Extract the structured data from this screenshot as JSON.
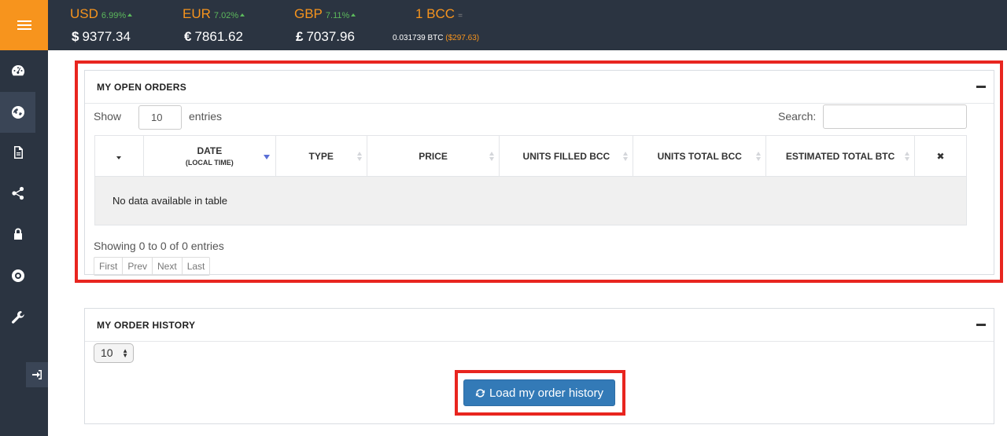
{
  "ticker": [
    {
      "code": "USD",
      "pct": "6.99%",
      "symbol": "$",
      "value": "9377.34"
    },
    {
      "code": "EUR",
      "pct": "7.02%",
      "symbol": "€",
      "value": "7861.62"
    },
    {
      "code": "GBP",
      "pct": "7.11%",
      "symbol": "£",
      "value": "7037.96"
    }
  ],
  "bcc": {
    "label": "1 BCC",
    "eq": "=",
    "btc": "0.031739 BTC",
    "usd": "($297.63)"
  },
  "open_orders": {
    "title": "MY OPEN ORDERS",
    "show_label": "Show",
    "entries_value": "10",
    "entries_label": "entries",
    "search_label": "Search:",
    "columns": [
      {
        "label": "",
        "sub": ""
      },
      {
        "label": "DATE",
        "sub": "(LOCAL TIME)"
      },
      {
        "label": "TYPE",
        "sub": ""
      },
      {
        "label": "PRICE",
        "sub": ""
      },
      {
        "label": "UNITS FILLED BCC",
        "sub": ""
      },
      {
        "label": "UNITS TOTAL BCC",
        "sub": ""
      },
      {
        "label": "ESTIMATED TOTAL BTC",
        "sub": ""
      },
      {
        "label": "✖",
        "sub": ""
      }
    ],
    "empty_text": "No data available in table",
    "showing_text": "Showing 0 to 0 of 0 entries",
    "pager": [
      "First",
      "Prev",
      "Next",
      "Last"
    ]
  },
  "order_history": {
    "title": "MY ORDER HISTORY",
    "select_value": "10",
    "load_button": "Load my order history"
  },
  "colors": {
    "accent": "#f7941d",
    "nav": "#2b3441",
    "highlight": "#e8251f",
    "primary": "#337ab7",
    "up": "#5cb85c"
  },
  "icons": [
    "menu-icon",
    "dashboard-icon",
    "globe-icon",
    "document-icon",
    "share-icon",
    "lock-icon",
    "support-icon",
    "wrench-icon",
    "logout-icon",
    "refresh-icon",
    "sort-icon",
    "close-icon",
    "minus-icon"
  ]
}
